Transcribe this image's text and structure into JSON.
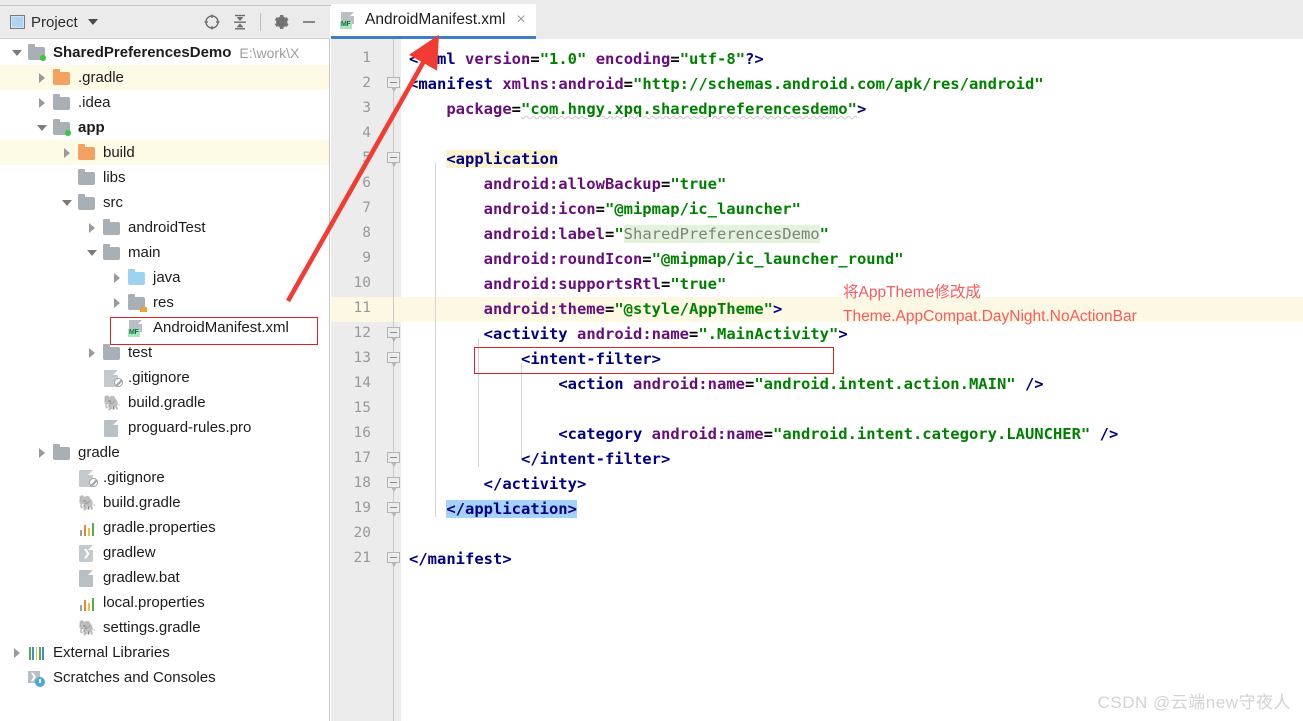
{
  "window": {
    "panel_title": "Project",
    "panel_icon": "project-window-icon",
    "toolbar_icons": [
      "locate-target-icon",
      "collapse-all-icon",
      "gear-icon",
      "minimize-icon"
    ]
  },
  "tree": {
    "items": [
      {
        "label": "SharedPreferencesDemo",
        "path": "E:\\work\\X",
        "icon": "module-folder-icon",
        "arrow": "down",
        "depth": 0,
        "bold": true,
        "excluded": false
      },
      {
        "label": ".gradle",
        "path": "",
        "icon": "folder-orange-icon",
        "arrow": "right",
        "depth": 1,
        "bold": false,
        "excluded": true
      },
      {
        "label": ".idea",
        "path": "",
        "icon": "folder-icon",
        "arrow": "right",
        "depth": 1,
        "bold": false,
        "excluded": false
      },
      {
        "label": "app",
        "path": "",
        "icon": "module-folder-icon",
        "arrow": "down",
        "depth": 1,
        "bold": true,
        "excluded": false
      },
      {
        "label": "build",
        "path": "",
        "icon": "folder-orange-icon",
        "arrow": "right",
        "depth": 2,
        "bold": false,
        "excluded": true
      },
      {
        "label": "libs",
        "path": "",
        "icon": "folder-icon",
        "arrow": "none",
        "depth": 2,
        "bold": false,
        "excluded": false
      },
      {
        "label": "src",
        "path": "",
        "icon": "folder-icon",
        "arrow": "down",
        "depth": 2,
        "bold": false,
        "excluded": false
      },
      {
        "label": "androidTest",
        "path": "",
        "icon": "folder-icon",
        "arrow": "right",
        "depth": 3,
        "bold": false,
        "excluded": false
      },
      {
        "label": "main",
        "path": "",
        "icon": "folder-icon",
        "arrow": "down",
        "depth": 3,
        "bold": false,
        "excluded": false
      },
      {
        "label": "java",
        "path": "",
        "icon": "folder-blue-icon",
        "arrow": "right",
        "depth": 4,
        "bold": false,
        "excluded": false
      },
      {
        "label": "res",
        "path": "",
        "icon": "folder-res-icon",
        "arrow": "right",
        "depth": 4,
        "bold": false,
        "excluded": false
      },
      {
        "label": "AndroidManifest.xml",
        "path": "",
        "icon": "manifest-file-icon",
        "arrow": "none",
        "depth": 4,
        "bold": false,
        "excluded": false
      },
      {
        "label": "test",
        "path": "",
        "icon": "folder-icon",
        "arrow": "right",
        "depth": 3,
        "bold": false,
        "excluded": false
      },
      {
        "label": ".gitignore",
        "path": "",
        "icon": "gitignore-file-icon",
        "arrow": "none",
        "depth": 3,
        "bold": false,
        "excluded": false
      },
      {
        "label": "build.gradle",
        "path": "",
        "icon": "gradle-file-icon",
        "arrow": "none",
        "depth": 3,
        "bold": false,
        "excluded": false
      },
      {
        "label": "proguard-rules.pro",
        "path": "",
        "icon": "text-file-icon",
        "arrow": "none",
        "depth": 3,
        "bold": false,
        "excluded": false
      },
      {
        "label": "gradle",
        "path": "",
        "icon": "folder-icon",
        "arrow": "right",
        "depth": 1,
        "bold": false,
        "excluded": false
      },
      {
        "label": ".gitignore",
        "path": "",
        "icon": "gitignore-file-icon",
        "arrow": "none",
        "depth": 2,
        "bold": false,
        "excluded": false
      },
      {
        "label": "build.gradle",
        "path": "",
        "icon": "gradle-file-icon",
        "arrow": "none",
        "depth": 2,
        "bold": false,
        "excluded": false
      },
      {
        "label": "gradle.properties",
        "path": "",
        "icon": "properties-file-icon",
        "arrow": "none",
        "depth": 2,
        "bold": false,
        "excluded": false
      },
      {
        "label": "gradlew",
        "path": "",
        "icon": "script-file-icon",
        "arrow": "none",
        "depth": 2,
        "bold": false,
        "excluded": false
      },
      {
        "label": "gradlew.bat",
        "path": "",
        "icon": "text-file-icon",
        "arrow": "none",
        "depth": 2,
        "bold": false,
        "excluded": false
      },
      {
        "label": "local.properties",
        "path": "",
        "icon": "properties-file-icon",
        "arrow": "none",
        "depth": 2,
        "bold": false,
        "excluded": false
      },
      {
        "label": "settings.gradle",
        "path": "",
        "icon": "gradle-file-icon",
        "arrow": "none",
        "depth": 2,
        "bold": false,
        "excluded": false
      },
      {
        "label": "External Libraries",
        "path": "",
        "icon": "external-libraries-icon",
        "arrow": "right",
        "depth": 0,
        "bold": false,
        "excluded": false
      },
      {
        "label": "Scratches and Consoles",
        "path": "",
        "icon": "scratches-icon",
        "arrow": "none",
        "depth": 0,
        "bold": false,
        "excluded": false
      }
    ],
    "highlighted_file": "AndroidManifest.xml"
  },
  "editor": {
    "tab": {
      "label": "AndroidManifest.xml",
      "icon": "manifest-file-icon",
      "close_glyph": "×"
    },
    "current_line": 11,
    "line_numbers": [
      1,
      2,
      3,
      4,
      5,
      6,
      7,
      8,
      9,
      10,
      11,
      12,
      13,
      14,
      15,
      16,
      17,
      18,
      19,
      20,
      21
    ],
    "lines": [
      {
        "n": 1,
        "text": "<?xml version=\"1.0\" encoding=\"utf-8\"?>"
      },
      {
        "n": 2,
        "text": "<manifest xmlns:android=\"http://schemas.android.com/apk/res/android\""
      },
      {
        "n": 3,
        "text": "    package=\"com.hngy.xpq.sharedpreferencesdemo\">"
      },
      {
        "n": 4,
        "text": ""
      },
      {
        "n": 5,
        "text": "    <application"
      },
      {
        "n": 6,
        "text": "        android:allowBackup=\"true\""
      },
      {
        "n": 7,
        "text": "        android:icon=\"@mipmap/ic_launcher\""
      },
      {
        "n": 8,
        "text": "        android:label=\"SharedPreferencesDemo\""
      },
      {
        "n": 9,
        "text": "        android:roundIcon=\"@mipmap/ic_launcher_round\""
      },
      {
        "n": 10,
        "text": "        android:supportsRtl=\"true\""
      },
      {
        "n": 11,
        "text": "        android:theme=\"@style/AppTheme\">"
      },
      {
        "n": 12,
        "text": "        <activity android:name=\".MainActivity\">"
      },
      {
        "n": 13,
        "text": "            <intent-filter>"
      },
      {
        "n": 14,
        "text": "                <action android:name=\"android.intent.action.MAIN\" />"
      },
      {
        "n": 15,
        "text": ""
      },
      {
        "n": 16,
        "text": "                <category android:name=\"android.intent.category.LAUNCHER\" />"
      },
      {
        "n": 17,
        "text": "            </intent-filter>"
      },
      {
        "n": 18,
        "text": "        </activity>"
      },
      {
        "n": 19,
        "text": "    </application>"
      },
      {
        "n": 20,
        "text": ""
      },
      {
        "n": 21,
        "text": "</manifest>"
      }
    ]
  },
  "annotation": {
    "line1": "将AppTheme修改成",
    "line2": "Theme.AppCompat.DayNight.NoActionBar",
    "color": "#fa5a5a"
  },
  "watermark": "CSDN @云端new守夜人",
  "colors": {
    "tab_underline": "#3d7ec4",
    "current_line": "#fcf8e3",
    "selection_blue": "#a6d2fa",
    "annotation_red": "#e02020",
    "excluded_row": "#fdfbe5",
    "xml_tag": "#000080",
    "xml_attr": "#660e7a",
    "xml_value": "#008000"
  }
}
